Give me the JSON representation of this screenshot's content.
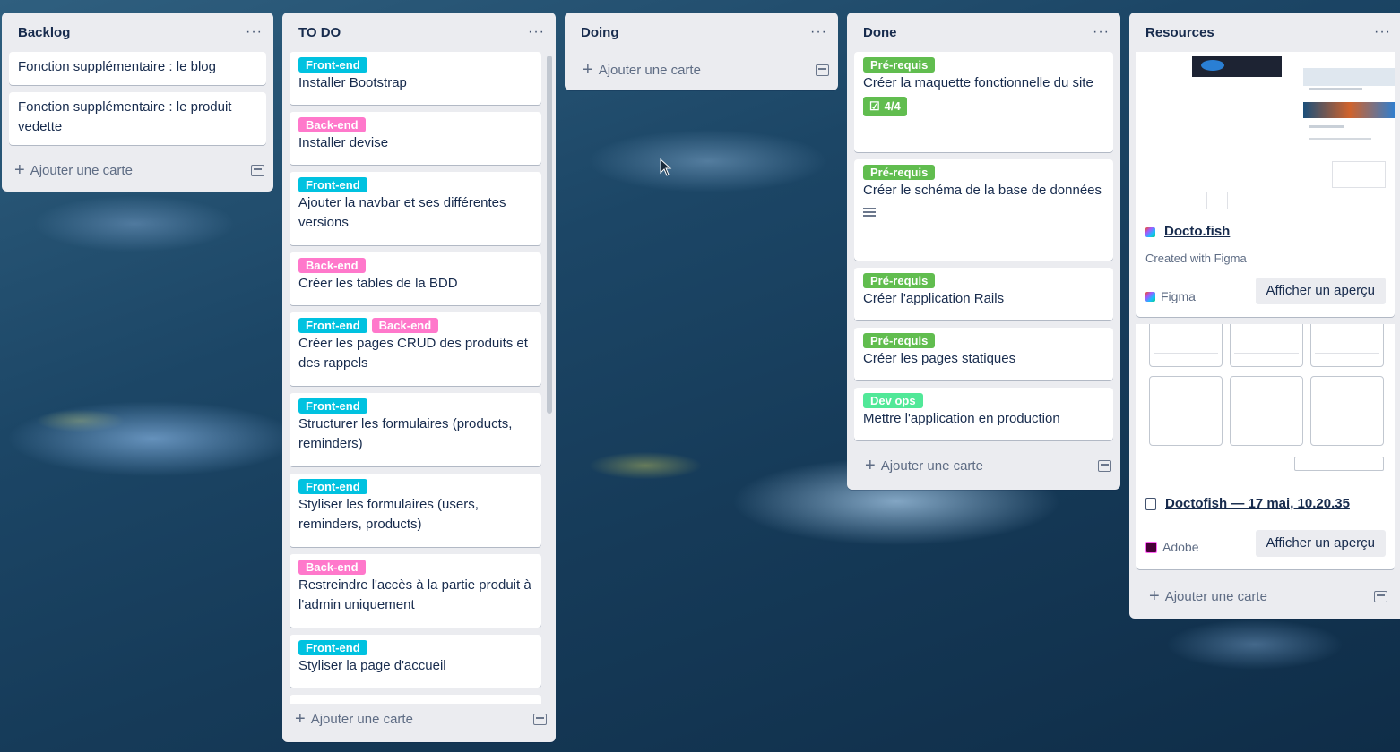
{
  "colors": {
    "front_end": "#00c2e0",
    "back_end": "#ff78cb",
    "pre_requis": "#61bd4f",
    "dev_ops": "#51e898"
  },
  "lists": {
    "backlog": {
      "title": "Backlog",
      "menu": "···",
      "cards": [
        "Fonction supplémentaire : le blog",
        "Fonction supplémentaire : le produit vedette"
      ],
      "add": "Ajouter une carte"
    },
    "todo": {
      "title": "TO DO",
      "menu": "···",
      "cards": [
        {
          "labels": [
            "Front-end"
          ],
          "text": "Installer Bootstrap"
        },
        {
          "labels": [
            "Back-end"
          ],
          "text": "Installer devise"
        },
        {
          "labels": [
            "Front-end"
          ],
          "text": "Ajouter la navbar et ses différentes versions"
        },
        {
          "labels": [
            "Back-end"
          ],
          "text": "Créer les tables de la BDD"
        },
        {
          "labels": [
            "Front-end",
            "Back-end"
          ],
          "text": "Créer les pages CRUD des produits et des rappels"
        },
        {
          "labels": [
            "Front-end"
          ],
          "text": "Structurer les formulaires (products, reminders)"
        },
        {
          "labels": [
            "Front-end"
          ],
          "text": "Styliser les formulaires (users, reminders, products)"
        },
        {
          "labels": [
            "Back-end"
          ],
          "text": "Restreindre l'accès à la partie produit à l'admin uniquement"
        },
        {
          "labels": [
            "Front-end"
          ],
          "text": "Styliser la page d'accueil"
        }
      ],
      "add": "Ajouter une carte"
    },
    "doing": {
      "title": "Doing",
      "menu": "···",
      "add": "Ajouter une carte"
    },
    "done": {
      "title": "Done",
      "menu": "···",
      "cards": [
        {
          "label": "Pré-requis",
          "text": "Créer la maquette fonctionnelle du site",
          "checklist": "4/4"
        },
        {
          "label": "Pré-requis",
          "text": "Créer le schéma de la base de données",
          "has_description": true
        },
        {
          "label": "Pré-requis",
          "text": "Créer l'application Rails"
        },
        {
          "label": "Pré-requis",
          "text": "Créer les pages statiques"
        },
        {
          "label": "Dev ops",
          "text": "Mettre l'application en production"
        }
      ],
      "add": "Ajouter une carte"
    },
    "resources": {
      "title": "Resources",
      "menu": "···",
      "attachments": [
        {
          "title": "Docto.fish",
          "subtitle": "Created with Figma",
          "source": "Figma",
          "button": "Afficher un aperçu"
        },
        {
          "title": "Doctofish — 17 mai, 10.20.35",
          "source": "Adobe",
          "button": "Afficher un aperçu"
        }
      ],
      "add": "Ajouter une carte"
    }
  }
}
